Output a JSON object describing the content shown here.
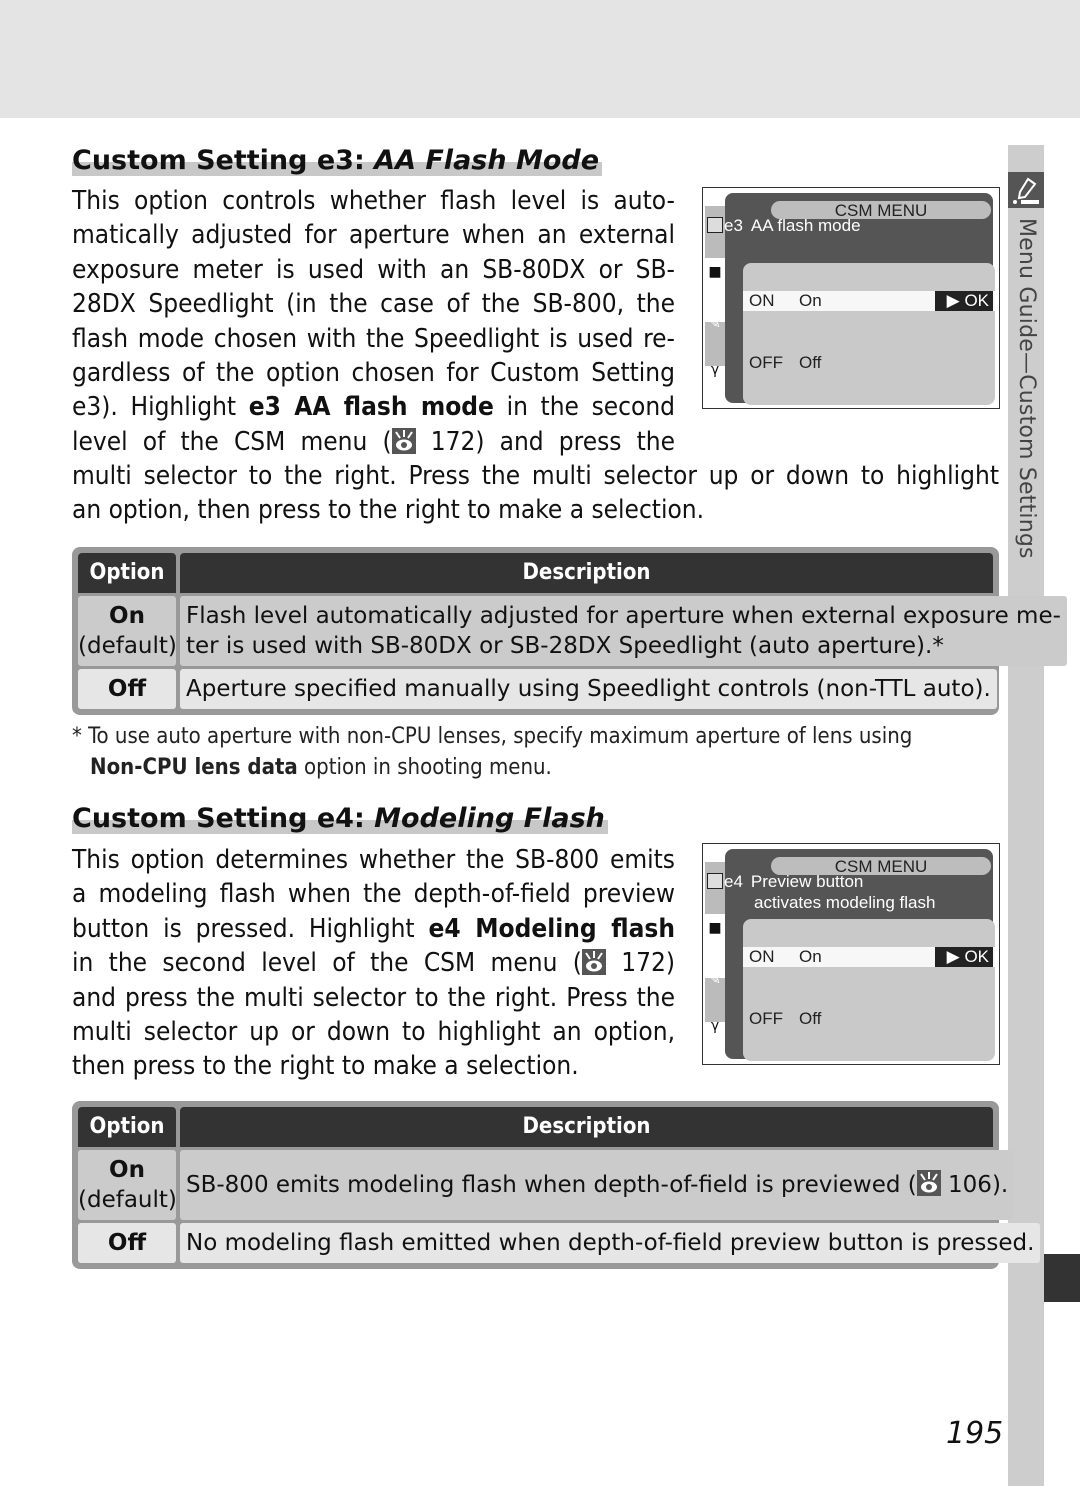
{
  "side_tab": {
    "label": "Menu Guide—Custom Settings",
    "icon": "pencil-icon"
  },
  "section_e3": {
    "heading_prefix": "Custom Setting e3: ",
    "heading_italic": "AA Flash Mode",
    "para_lines": [
      "This option controls whether flash level is auto-",
      "matically adjusted for aperture when an external",
      "exposure meter is used with an SB-80DX or SB-",
      "28DX Speedlight (in the case of the SB-800, the",
      "flash mode chosen with the Speedlight is used re-",
      "gardless of the option chosen for Custom Setting"
    ],
    "line7_pre": "e3).  Highlight ",
    "line7_bold": "e3 AA flash mode",
    "line7_post": " in the second",
    "line8_pre": "level of the CSM menu (",
    "line8_ref": " 172) and press the",
    "wide_lines": [
      "multi selector to the right.  Press the multi selector up or down to highlight",
      "an option, then press to the right to make a selection."
    ],
    "screen": {
      "menu_title": "CSM MENU",
      "item_code": "e3",
      "item_lines": [
        "AA flash mode"
      ],
      "options": [
        {
          "key": "ON",
          "label": "On",
          "selected": true
        },
        {
          "key": "OFF",
          "label": "Off",
          "selected": false
        }
      ],
      "ok_label": "▶ OK"
    },
    "table": {
      "headers": [
        "Option",
        "Description"
      ],
      "rows": [
        {
          "option": "On",
          "note": "(default)",
          "desc_lines": [
            "Flash level automatically adjusted for aperture when external exposure me-",
            "ter is used with SB-80DX or SB-28DX Speedlight (auto aperture).*"
          ]
        },
        {
          "option": "Off",
          "note": "",
          "desc_lines": [
            "Aperture specified manually using Speedlight controls (non-TTL auto)."
          ]
        }
      ]
    },
    "footnote_line1": "* To use auto aperture with non-CPU lenses, specify maximum aperture of lens using",
    "footnote_bold": "Non-CPU lens data",
    "footnote_rest": " option in shooting menu."
  },
  "section_e4": {
    "heading_prefix": "Custom Setting e4: ",
    "heading_italic": "Modeling Flash",
    "para_lines": [
      "This option determines whether the SB-800 emits",
      "a modeling flash when the depth-of-field preview"
    ],
    "line3_pre": "button is pressed.  Highlight ",
    "line3_bold": "e4 Modeling flash",
    "line4_pre": "in the second level of the CSM menu (",
    "line4_ref": " 172)",
    "tail_lines": [
      "and press the multi selector to the right.  Press the",
      "multi selector up or down to highlight an option,",
      "then press to the right to make a selection."
    ],
    "screen": {
      "menu_title": "CSM MENU",
      "item_code": "e4",
      "item_lines": [
        "Preview button",
        "activates modeling flash"
      ],
      "options": [
        {
          "key": "ON",
          "label": "On",
          "selected": true
        },
        {
          "key": "OFF",
          "label": "Off",
          "selected": false
        }
      ],
      "ok_label": "▶ OK"
    },
    "table": {
      "headers": [
        "Option",
        "Description"
      ],
      "rows": [
        {
          "option": "On",
          "note": "(default)",
          "desc_pre": "SB-800 emits modeling flash when depth-of-field is previewed (",
          "desc_ref": " 106)."
        },
        {
          "option": "Off",
          "note": "",
          "desc_lines": [
            "No modeling flash emitted when depth-of-field preview button is pressed."
          ]
        }
      ]
    }
  },
  "page_number": "195"
}
